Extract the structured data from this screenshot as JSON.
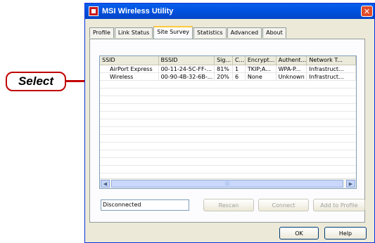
{
  "callout": {
    "label": "Select"
  },
  "window": {
    "title": "MSI Wireless Utility",
    "close_glyph": "✕"
  },
  "tabs": [
    {
      "label": "Profile"
    },
    {
      "label": "Link Status"
    },
    {
      "label": "Site Survey",
      "active": true
    },
    {
      "label": "Statistics"
    },
    {
      "label": "Advanced"
    },
    {
      "label": "About"
    }
  ],
  "network_list": {
    "columns": [
      "SSID",
      "BSSID",
      "Sig...",
      "C...",
      "Encrypt...",
      "Authent...",
      "Network T..."
    ],
    "rows": [
      [
        "AirPort Express",
        "00-11-24-5C-FF-...",
        "81%",
        "1",
        "TKIP;A...",
        "WPA-P...",
        "Infrastruct..."
      ],
      [
        "Wireless",
        "00-90-4B-32-6B-...",
        "20%",
        "6",
        "None",
        "Unknown",
        "Infrastruct..."
      ]
    ],
    "scroll_left": "◀",
    "scroll_right": "▶",
    "scroll_thumb": "|||"
  },
  "status": {
    "text": "Disconnected"
  },
  "buttons": {
    "rescan": "Rescan",
    "connect": "Connect",
    "add_to_profile": "Add to Profile",
    "ok": "OK",
    "help": "Help"
  },
  "colors": {
    "callout_border": "#c00000",
    "titlebar": "#0053e2",
    "window_bg": "#ece9d8"
  }
}
